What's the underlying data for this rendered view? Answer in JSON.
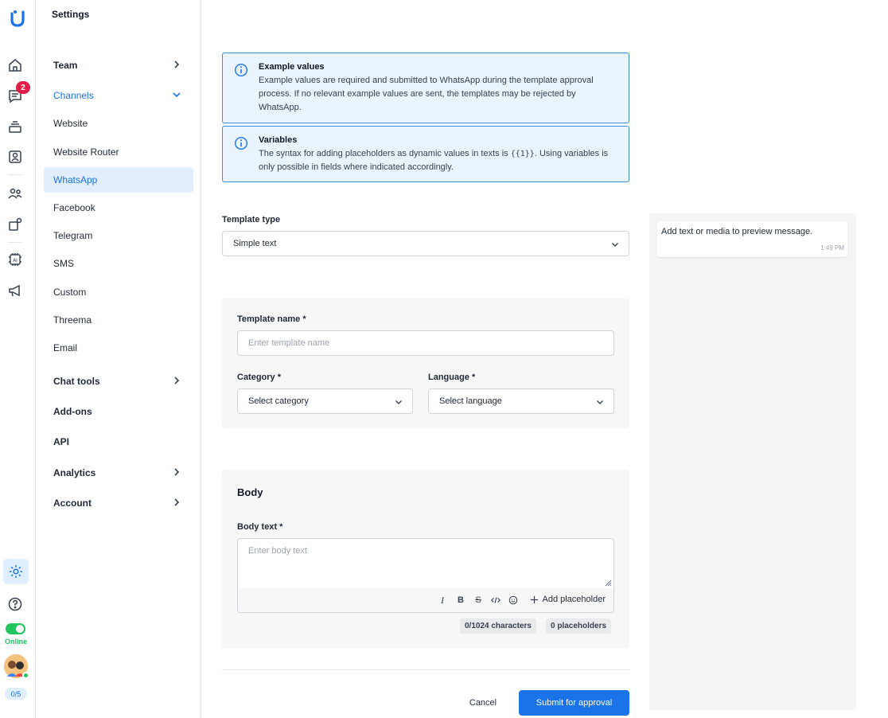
{
  "rail": {
    "notifications_count": "2",
    "status_label": "Online",
    "agents_count": "0/5"
  },
  "sidebar": {
    "title": "Settings",
    "items": [
      {
        "label": "Team"
      },
      {
        "label": "Channels"
      },
      {
        "label": "Website"
      },
      {
        "label": "Website Router"
      },
      {
        "label": "WhatsApp"
      },
      {
        "label": "Facebook"
      },
      {
        "label": "Telegram"
      },
      {
        "label": "SMS"
      },
      {
        "label": "Custom"
      },
      {
        "label": "Threema"
      },
      {
        "label": "Email"
      },
      {
        "label": "Chat tools"
      },
      {
        "label": "Add-ons"
      },
      {
        "label": "API"
      },
      {
        "label": "Analytics"
      },
      {
        "label": "Account"
      }
    ]
  },
  "info": {
    "example": {
      "title": "Example values",
      "text": "Example values are required and submitted to WhatsApp during the template approval process. If no relevant example values are sent, the templates may be rejected by WhatsApp."
    },
    "variables": {
      "title": "Variables",
      "text_before": "The syntax for adding placeholders as dynamic values in texts is ",
      "code": "{{1}}",
      "text_after": ". Using variables is only possible in fields where indicated accordingly."
    }
  },
  "form": {
    "template_type_label": "Template type",
    "template_type_value": "Simple text",
    "template_name_label": "Template name *",
    "template_name_placeholder": "Enter template name",
    "category_label": "Category *",
    "category_value": "Select category",
    "language_label": "Language *",
    "language_value": "Select language",
    "body_title": "Body",
    "body_text_label": "Body text *",
    "body_placeholder": "Enter body text",
    "add_placeholder_label": "Add placeholder",
    "char_count": "0/1024 characters",
    "placeholder_count": "0 placeholders",
    "cancel_label": "Cancel",
    "submit_label": "Submit for approval"
  },
  "preview": {
    "message": "Add text or media to preview message.",
    "time": "1:49 PM"
  },
  "colors": {
    "accent": "#1a73e8",
    "info_border": "#3b8fd9",
    "info_bg": "#eaf4fd",
    "online": "#22c55e",
    "badge": "#e11d48"
  }
}
